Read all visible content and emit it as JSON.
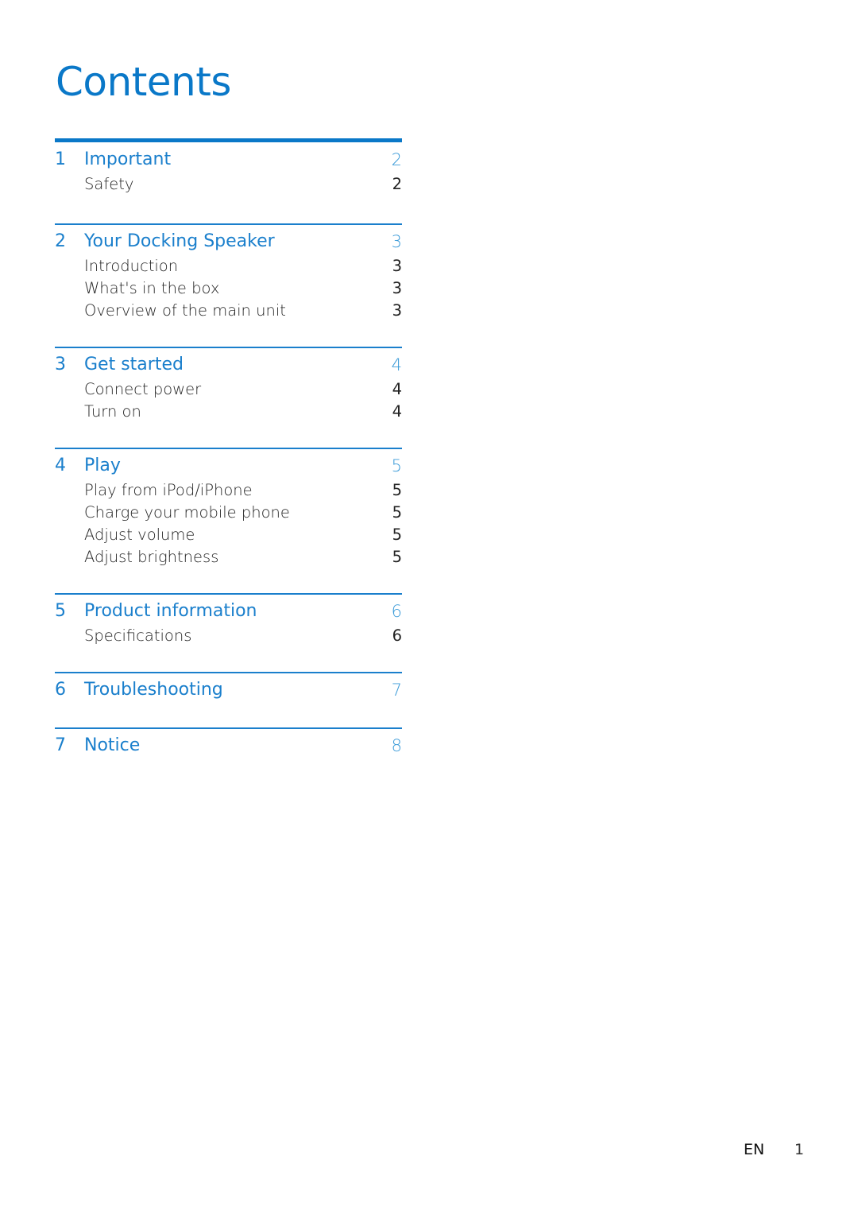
{
  "title": "Contents",
  "sections": [
    {
      "number": "1",
      "title": "Important",
      "page": "2",
      "items": [
        {
          "label": "Safety",
          "page": "2"
        }
      ]
    },
    {
      "number": "2",
      "title": "Your Docking Speaker",
      "page": "3",
      "items": [
        {
          "label": "Introduction",
          "page": "3"
        },
        {
          "label": "What's in the box",
          "page": "3"
        },
        {
          "label": "Overview of the main unit",
          "page": "3"
        }
      ]
    },
    {
      "number": "3",
      "title": "Get started",
      "page": "4",
      "items": [
        {
          "label": "Connect power",
          "page": "4"
        },
        {
          "label": "Turn on",
          "page": "4"
        }
      ]
    },
    {
      "number": "4",
      "title": "Play",
      "page": "5",
      "items": [
        {
          "label": "Play from iPod/iPhone",
          "page": "5"
        },
        {
          "label": "Charge your mobile phone",
          "page": "5"
        },
        {
          "label": "Adjust volume",
          "page": "5"
        },
        {
          "label": "Adjust brightness",
          "page": "5"
        }
      ]
    },
    {
      "number": "5",
      "title": "Product information",
      "page": "6",
      "items": [
        {
          "label": "Specifications",
          "page": "6"
        }
      ]
    },
    {
      "number": "6",
      "title": "Troubleshooting",
      "page": "7",
      "items": []
    },
    {
      "number": "7",
      "title": "Notice",
      "page": "8",
      "items": []
    }
  ],
  "footer": {
    "language": "EN",
    "page": "1"
  }
}
